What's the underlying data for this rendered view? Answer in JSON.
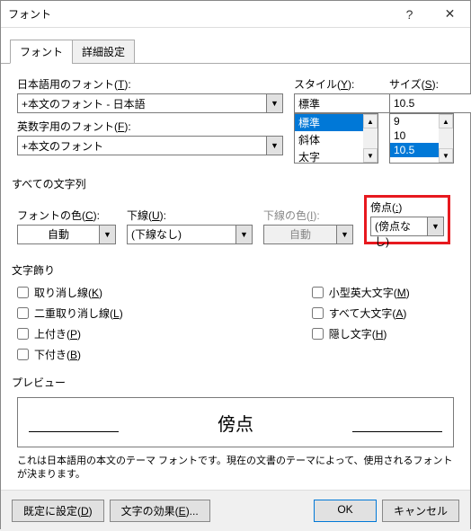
{
  "title": "フォント",
  "tabs": {
    "font": "フォント",
    "advanced": "詳細設定"
  },
  "jpFont": {
    "label": "日本語用のフォント(",
    "hotkey": "T",
    "labelEnd": "):",
    "value": "+本文のフォント - 日本語"
  },
  "enFont": {
    "label": "英数字用のフォント(",
    "hotkey": "F",
    "labelEnd": "):",
    "value": "+本文のフォント"
  },
  "style": {
    "label": "スタイル(",
    "hotkey": "Y",
    "labelEnd": "):",
    "value": "標準",
    "items": [
      "標準",
      "斜体",
      "太字"
    ]
  },
  "size": {
    "label": "サイズ(",
    "hotkey": "S",
    "labelEnd": "):",
    "value": "10.5",
    "items": [
      "9",
      "10",
      "10.5"
    ]
  },
  "allChars": "すべての文字列",
  "fontColor": {
    "label": "フォントの色(",
    "hotkey": "C",
    "labelEnd": "):",
    "value": "自動"
  },
  "underline": {
    "label": "下線(",
    "hotkey": "U",
    "labelEnd": "):",
    "value": "(下線なし)"
  },
  "underlineColor": {
    "label": "下線の色(",
    "hotkey": "I",
    "labelEnd": "):",
    "value": "自動"
  },
  "emphasis": {
    "label": "傍点(",
    "hotkey": ":",
    "labelEnd": ")",
    "value": "(傍点なし)"
  },
  "decoration": "文字飾り",
  "checks": {
    "strike": {
      "label": "取り消し線(",
      "hotkey": "K",
      "labelEnd": ")"
    },
    "dstrike": {
      "label": "二重取り消し線(",
      "hotkey": "L",
      "labelEnd": ")"
    },
    "sup": {
      "label": "上付き(",
      "hotkey": "P",
      "labelEnd": ")"
    },
    "sub": {
      "label": "下付き(",
      "hotkey": "B",
      "labelEnd": ")"
    },
    "smallcaps": {
      "label": "小型英大文字(",
      "hotkey": "M",
      "labelEnd": ")"
    },
    "allcaps": {
      "label": "すべて大文字(",
      "hotkey": "A",
      "labelEnd": ")"
    },
    "hidden": {
      "label": "隠し文字(",
      "hotkey": "H",
      "labelEnd": ")"
    }
  },
  "preview": {
    "label": "プレビュー",
    "text": "傍点"
  },
  "desc": "これは日本語用の本文のテーマ フォントです。現在の文書のテーマによって、使用されるフォントが決まります。",
  "footer": {
    "default": {
      "label": "既定に設定(",
      "hotkey": "D",
      "labelEnd": ")"
    },
    "effects": {
      "label": "文字の効果(",
      "hotkey": "E",
      "labelEnd": ")..."
    },
    "ok": "OK",
    "cancel": "キャンセル"
  }
}
